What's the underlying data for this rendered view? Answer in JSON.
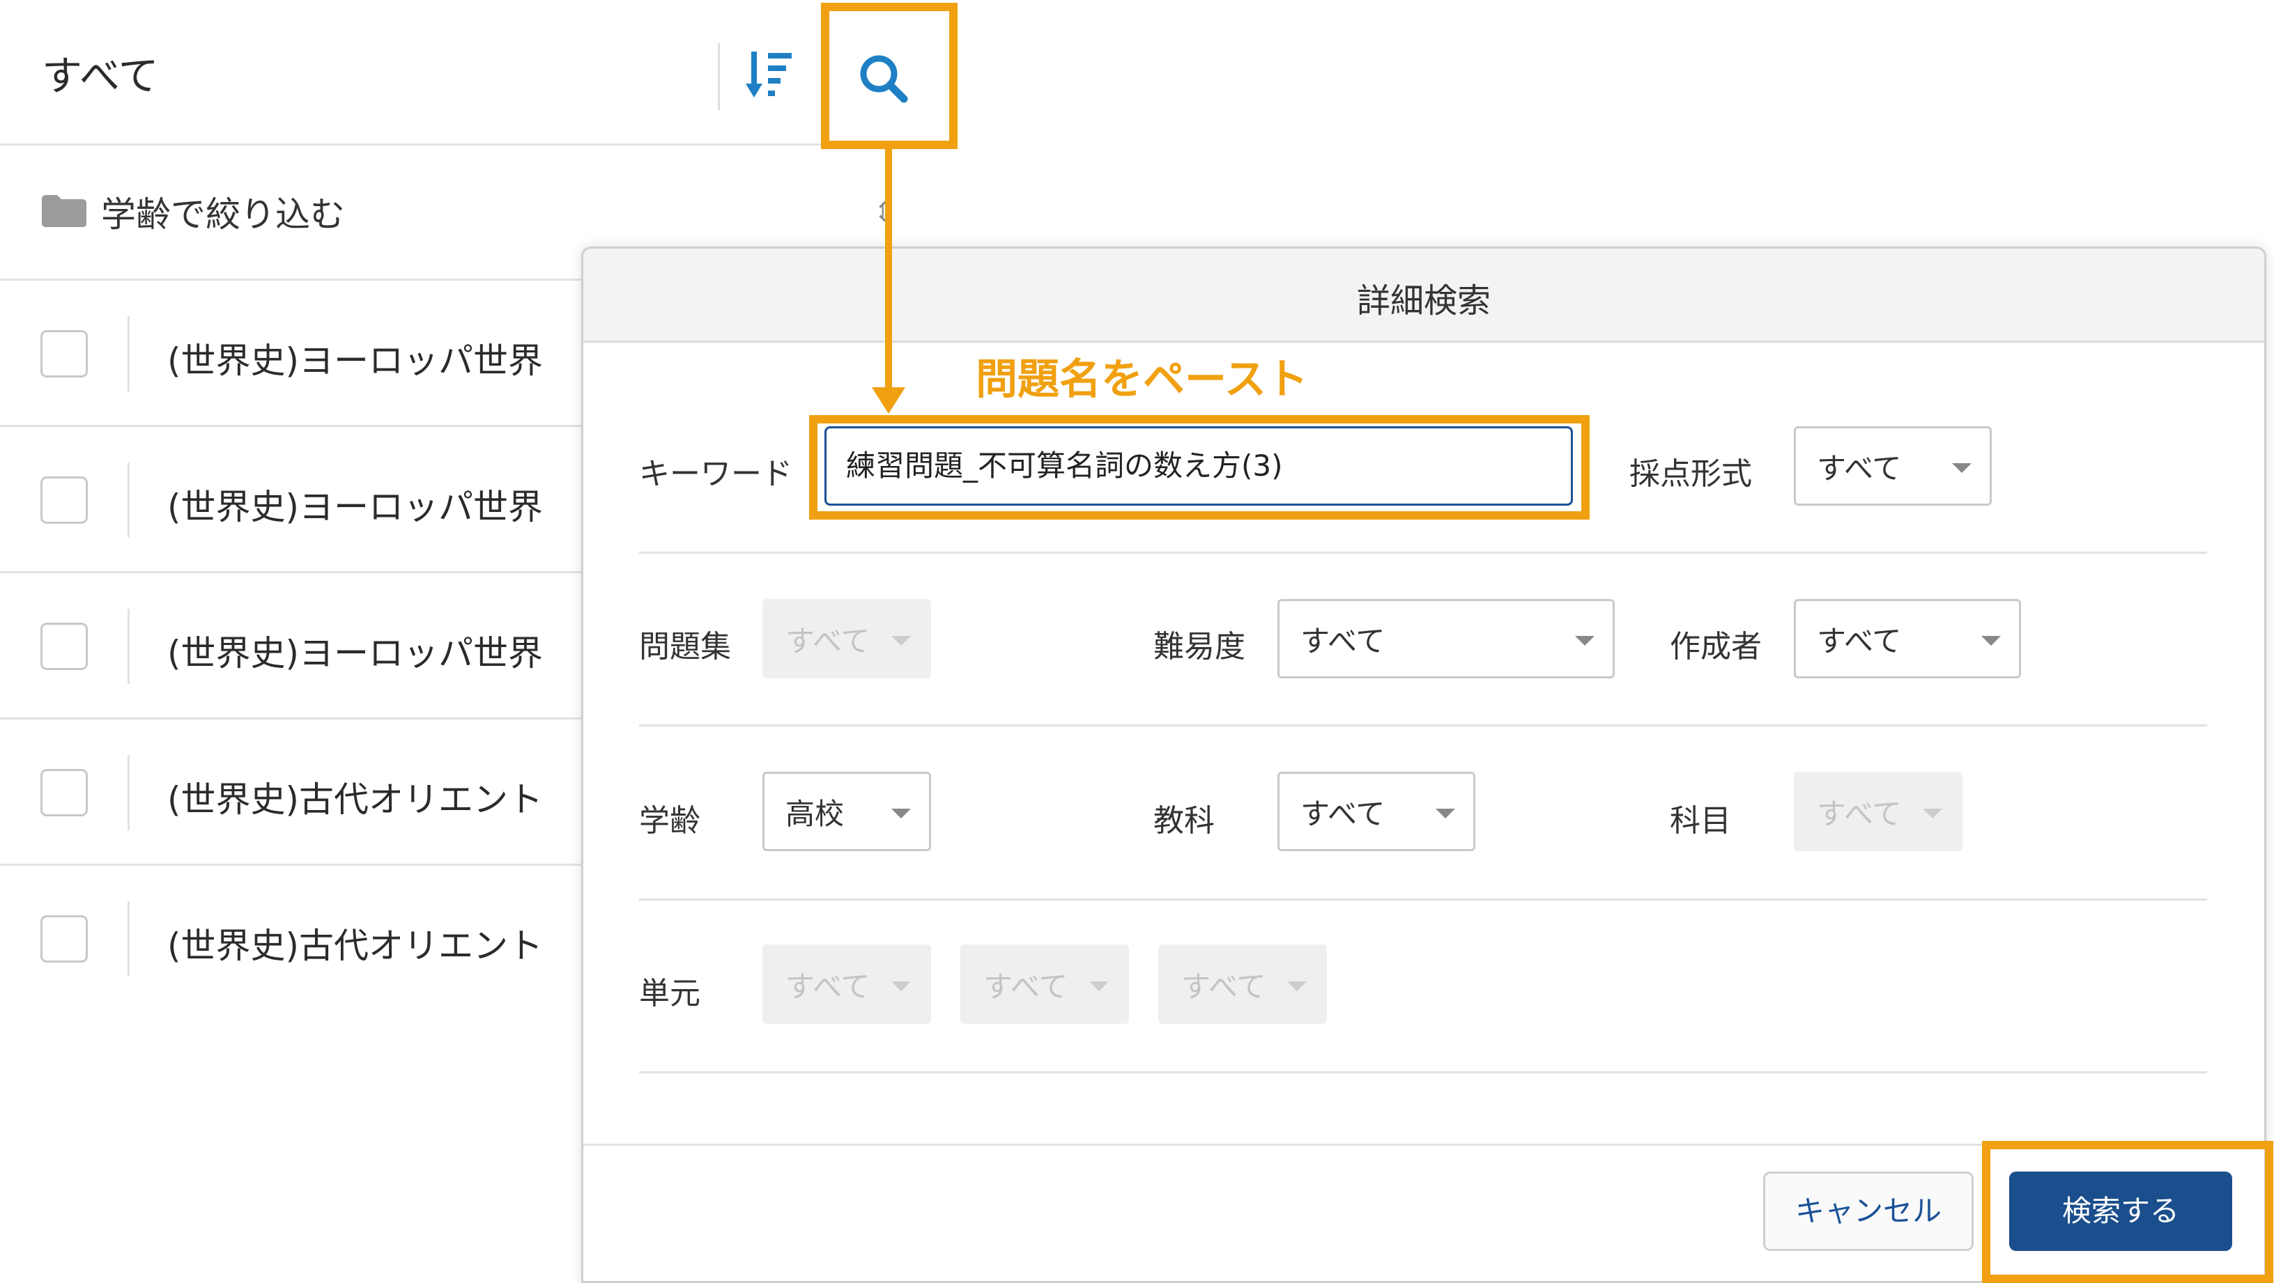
{
  "header": {
    "title": "すべて",
    "sort_icon": "sort-descending-icon",
    "search_icon": "search-icon"
  },
  "filter": {
    "label": "学齢で絞り込む",
    "icon": "folder-icon"
  },
  "list": {
    "rows": [
      {
        "text": "(世界史)ヨーロッパ世界"
      },
      {
        "text": "(世界史)ヨーロッパ世界"
      },
      {
        "text": "(世界史)ヨーロッパ世界"
      },
      {
        "text": "(世界史)古代オリエント"
      },
      {
        "text": "(世界史)古代オリエント"
      }
    ]
  },
  "annotation": {
    "text": "問題名をペースト"
  },
  "modal": {
    "title": "詳細検索",
    "keyword": {
      "label": "キーワード",
      "value": "練習問題_不可算名詞の数え方(3)"
    },
    "grading": {
      "label": "採点形式",
      "value": "すべて"
    },
    "question_set": {
      "label": "問題集",
      "value": "すべて"
    },
    "difficulty": {
      "label": "難易度",
      "value": "すべて"
    },
    "author": {
      "label": "作成者",
      "value": "すべて"
    },
    "grade": {
      "label": "学齢",
      "value": "高校"
    },
    "subject": {
      "label": "教科",
      "value": "すべて"
    },
    "course": {
      "label": "科目",
      "value": "すべて"
    },
    "unit": {
      "label": "単元",
      "values": [
        "すべて",
        "すべて",
        "すべて"
      ]
    },
    "cancel_label": "キャンセル",
    "submit_label": "検索する"
  },
  "colors": {
    "accent": "#1b5297",
    "highlight": "#f0a010",
    "primary_button": "#1b4e8c"
  }
}
